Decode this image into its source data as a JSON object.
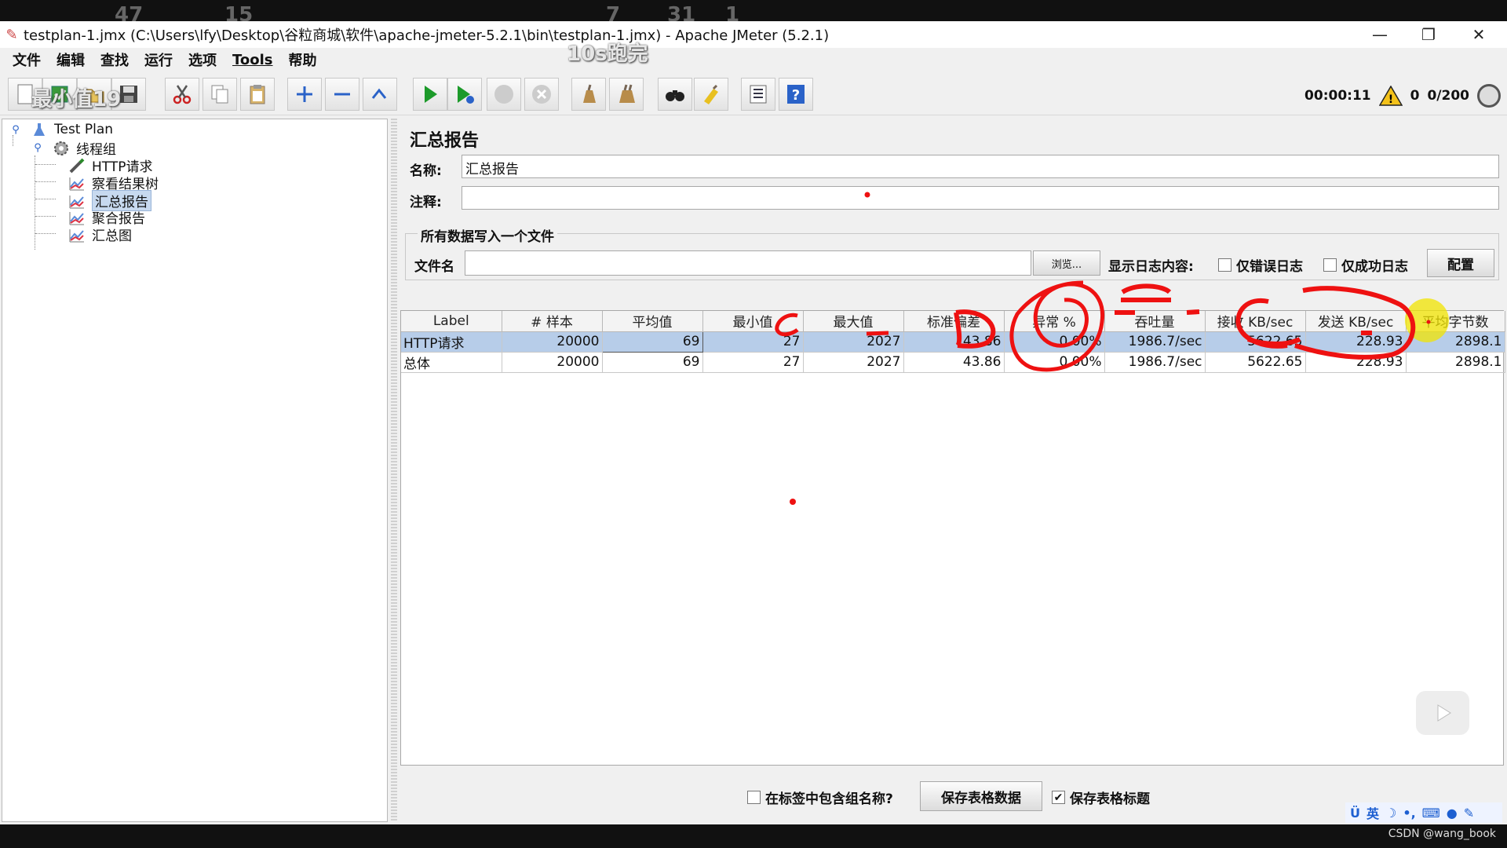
{
  "video_overlay": {
    "top_numbers": [
      "47",
      "15",
      "7",
      "31",
      "1"
    ],
    "subtitle_top": "10s跑完",
    "subtitle_left": "最小值19"
  },
  "window": {
    "title": "testplan-1.jmx (C:\\Users\\lfy\\Desktop\\谷粒商城\\软件\\apache-jmeter-5.2.1\\bin\\testplan-1.jmx) - Apache JMeter (5.2.1)",
    "minimize": "—",
    "restore": "❐",
    "close": "✕"
  },
  "menu": [
    "文件",
    "编辑",
    "查找",
    "运行",
    "选项",
    "Tools",
    "帮助"
  ],
  "toolbar": {
    "elapsed": "00:00:11",
    "warning_count": "0",
    "threads": "0/200"
  },
  "tree": {
    "root": "Test Plan",
    "thread_group": "线程组",
    "children": [
      "HTTP请求",
      "察看结果树",
      "汇总报告",
      "聚合报告",
      "汇总图"
    ]
  },
  "report": {
    "title": "汇总报告",
    "name_label": "名称:",
    "name_value": "汇总报告",
    "comment_label": "注释:",
    "comment_value": "",
    "group_title": "所有数据写入一个文件",
    "filename_label": "文件名",
    "filename_value": "",
    "browse_button": "浏览...",
    "log_label": "显示日志内容:",
    "errors_only": "仅错误日志",
    "success_only": "仅成功日志",
    "configure_button": "配置"
  },
  "table": {
    "columns": [
      "Label",
      "# 样本",
      "平均值",
      "最小值",
      "最大值",
      "标准偏差",
      "异常 %",
      "吞吐量",
      "接收 KB/sec",
      "发送 KB/sec",
      "平均字节数"
    ],
    "rows": [
      [
        "HTTP请求",
        "20000",
        "69",
        "27",
        "2027",
        "43.86",
        "0.00%",
        "1986.7/sec",
        "5622.65",
        "228.93",
        "2898.1"
      ],
      [
        "总体",
        "20000",
        "69",
        "27",
        "2027",
        "43.86",
        "0.00%",
        "1986.7/sec",
        "5622.65",
        "228.93",
        "2898.1"
      ]
    ]
  },
  "bottom": {
    "include_group_name": "在标签中包含组名称?",
    "save_table_data": "保存表格数据",
    "save_table_header": "保存表格标题"
  },
  "ime": {
    "lang": "英"
  },
  "watermark": "CSDN @wang_book",
  "colors": {
    "annotation_red": "#ee1111",
    "selection_blue": "#b7cde9",
    "highlighter_yellow": "#f2e400"
  }
}
